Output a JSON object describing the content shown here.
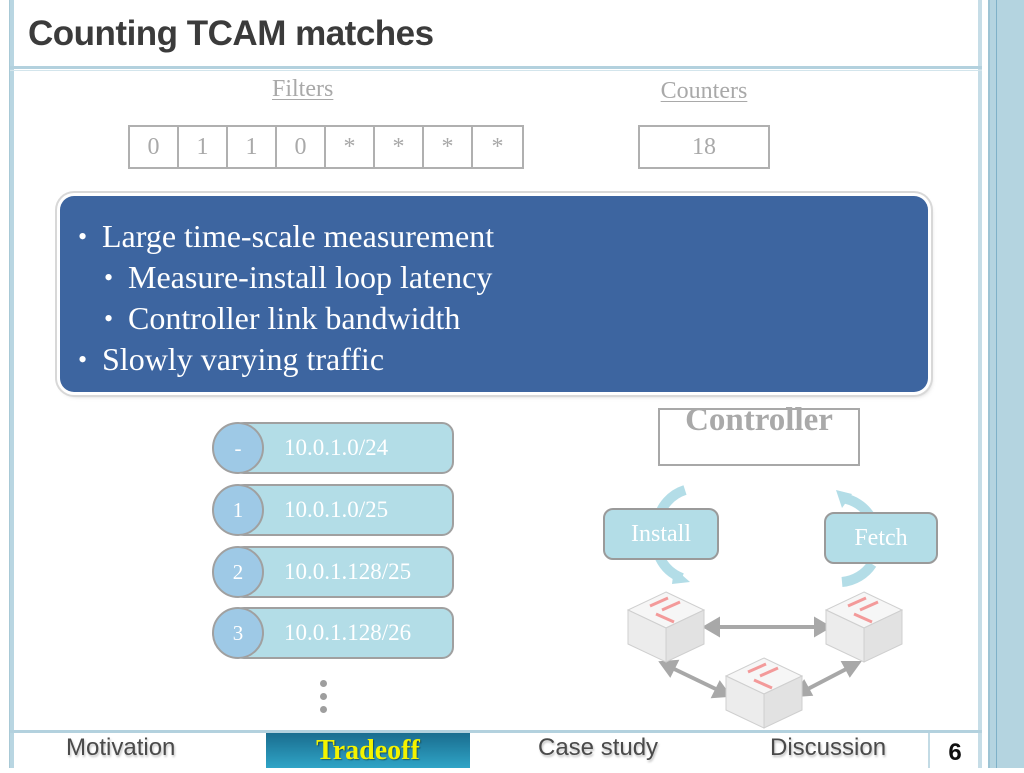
{
  "slide": {
    "title": "Counting TCAM matches",
    "page_number": "6"
  },
  "filters": {
    "label": "Filters",
    "bits": [
      "0",
      "1",
      "1",
      "0",
      "*",
      "*",
      "*",
      "*"
    ]
  },
  "counters": {
    "label": "Counters",
    "value": "18"
  },
  "callout": {
    "bullets": [
      {
        "text": "Large time-scale measurement",
        "level": 1
      },
      {
        "text": "Measure-install loop latency",
        "level": 2
      },
      {
        "text": "Controller link bandwidth",
        "level": 2
      },
      {
        "text": "Slowly varying traffic",
        "level": 1
      }
    ]
  },
  "rules": [
    {
      "index": "-",
      "prefix": "10.0.1.0/24"
    },
    {
      "index": "1",
      "prefix": "10.0.1.0/25"
    },
    {
      "index": "2",
      "prefix": "10.0.1.128/25"
    },
    {
      "index": "3",
      "prefix": "10.0.1.128/26"
    }
  ],
  "diagram": {
    "controller_label": "Controller",
    "install_label": "Install",
    "fetch_label": "Fetch",
    "switch_icon": "network-switch-icon",
    "accent_color": "#b3dde7"
  },
  "footer": {
    "tabs": [
      {
        "label": "Motivation",
        "active": false
      },
      {
        "label": "Tradeoff",
        "active": true
      },
      {
        "label": "Case study",
        "active": false
      },
      {
        "label": "Discussion",
        "active": false
      }
    ],
    "active_color": "#2a8fb3",
    "active_text_color": "#f3f300"
  }
}
